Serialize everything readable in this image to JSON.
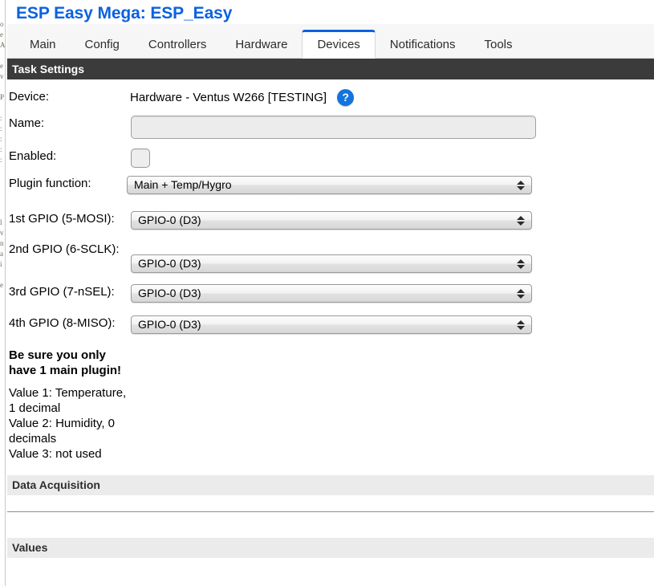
{
  "edge_strip": {
    "fragment_text": "o\ne\nA\n\ne\nv\n\nP\n\n:\n:\n:\n:\n:\n\n\n\n\n\nl\nv\nn\na\ni\n\ne\n"
  },
  "header": {
    "title": "ESP Easy Mega: ESP_Easy",
    "title_color": "#0a62e0"
  },
  "tabs": [
    {
      "label": "Main",
      "active": false
    },
    {
      "label": "Config",
      "active": false
    },
    {
      "label": "Controllers",
      "active": false
    },
    {
      "label": "Hardware",
      "active": false
    },
    {
      "label": "Devices",
      "active": true
    },
    {
      "label": "Notifications",
      "active": false
    },
    {
      "label": "Tools",
      "active": false
    }
  ],
  "sections": {
    "task_settings": "Task Settings",
    "data_acquisition": "Data Acquisition",
    "values": "Values"
  },
  "form": {
    "device": {
      "label": "Device:",
      "value": "Hardware - Ventus W266 [TESTING]",
      "help_icon": "question-mark-icon",
      "help_glyph": "?"
    },
    "name": {
      "label": "Name:",
      "value": "",
      "placeholder": ""
    },
    "enabled": {
      "label": "Enabled:",
      "checked": false
    },
    "plugin_function": {
      "label": "Plugin function:",
      "value": "Main + Temp/Hygro"
    },
    "gpio": [
      {
        "label": "1st GPIO (5-MOSI):",
        "value": "GPIO-0 (D3)"
      },
      {
        "label": "2nd GPIO (6-SCLK):",
        "value": "GPIO-0 (D3)"
      },
      {
        "label": "3rd GPIO (7-nSEL):",
        "value": "GPIO-0 (D3)"
      },
      {
        "label": "4th GPIO (8-MISO):",
        "value": "GPIO-0 (D3)"
      }
    ]
  },
  "notes": {
    "warning": "Be sure you only have 1 main plugin!",
    "values_info": "Value 1: Temperature, 1 decimal\nValue 2: Humidity, 0 decimals\nValue 3: not used"
  },
  "colors": {
    "accent_blue": "#0a62e0",
    "help_blue": "#1374dd",
    "dark_bar": "#3b3b3b",
    "grey_bar": "#ebebeb",
    "tabbar_bg": "#f6f6f6"
  }
}
